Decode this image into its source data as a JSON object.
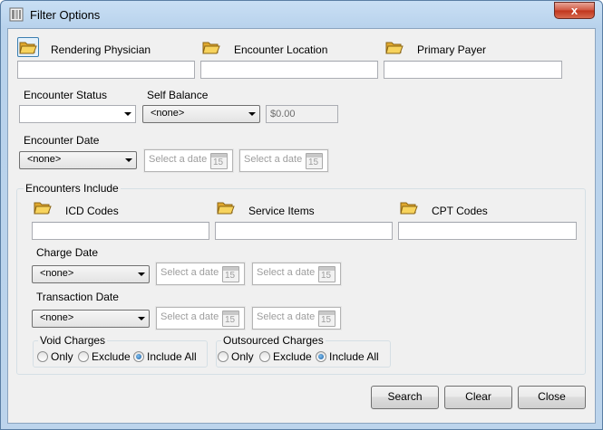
{
  "window": {
    "title": "Filter Options",
    "close_glyph": "x"
  },
  "pickers": {
    "rendering_physician": "Rendering Physician",
    "encounter_location": "Encounter Location",
    "primary_payer": "Primary Payer"
  },
  "encounter_status": {
    "label": "Encounter Status",
    "value": ""
  },
  "self_balance": {
    "label": "Self Balance",
    "value": "<none>",
    "amount": "$0.00"
  },
  "encounter_date": {
    "label": "Encounter Date",
    "value": "<none>",
    "from_placeholder": "Select a date",
    "to_placeholder": "Select a date"
  },
  "encounters_include": {
    "title": "Encounters Include",
    "pickers": {
      "icd_codes": "ICD Codes",
      "service_items": "Service Items",
      "cpt_codes": "CPT Codes"
    },
    "charge_date": {
      "label": "Charge Date",
      "value": "<none>",
      "from_placeholder": "Select a date",
      "to_placeholder": "Select a date"
    },
    "transaction_date": {
      "label": "Transaction Date",
      "value": "<none>",
      "from_placeholder": "Select a date",
      "to_placeholder": "Select a date"
    },
    "void_charges": {
      "title": "Void Charges",
      "options": [
        "Only",
        "Exclude",
        "Include All"
      ],
      "selected": "Include All"
    },
    "outsourced_charges": {
      "title": "Outsourced Charges",
      "options": [
        "Only",
        "Exclude",
        "Include All"
      ],
      "selected": "Include All"
    }
  },
  "calendar_icon_day": "15",
  "buttons": {
    "search": "Search",
    "clear": "Clear",
    "close": "Close"
  },
  "icons": {
    "app": "filter-window-icon",
    "picker": "open-folder-icon",
    "calendar": "calendar-icon"
  }
}
